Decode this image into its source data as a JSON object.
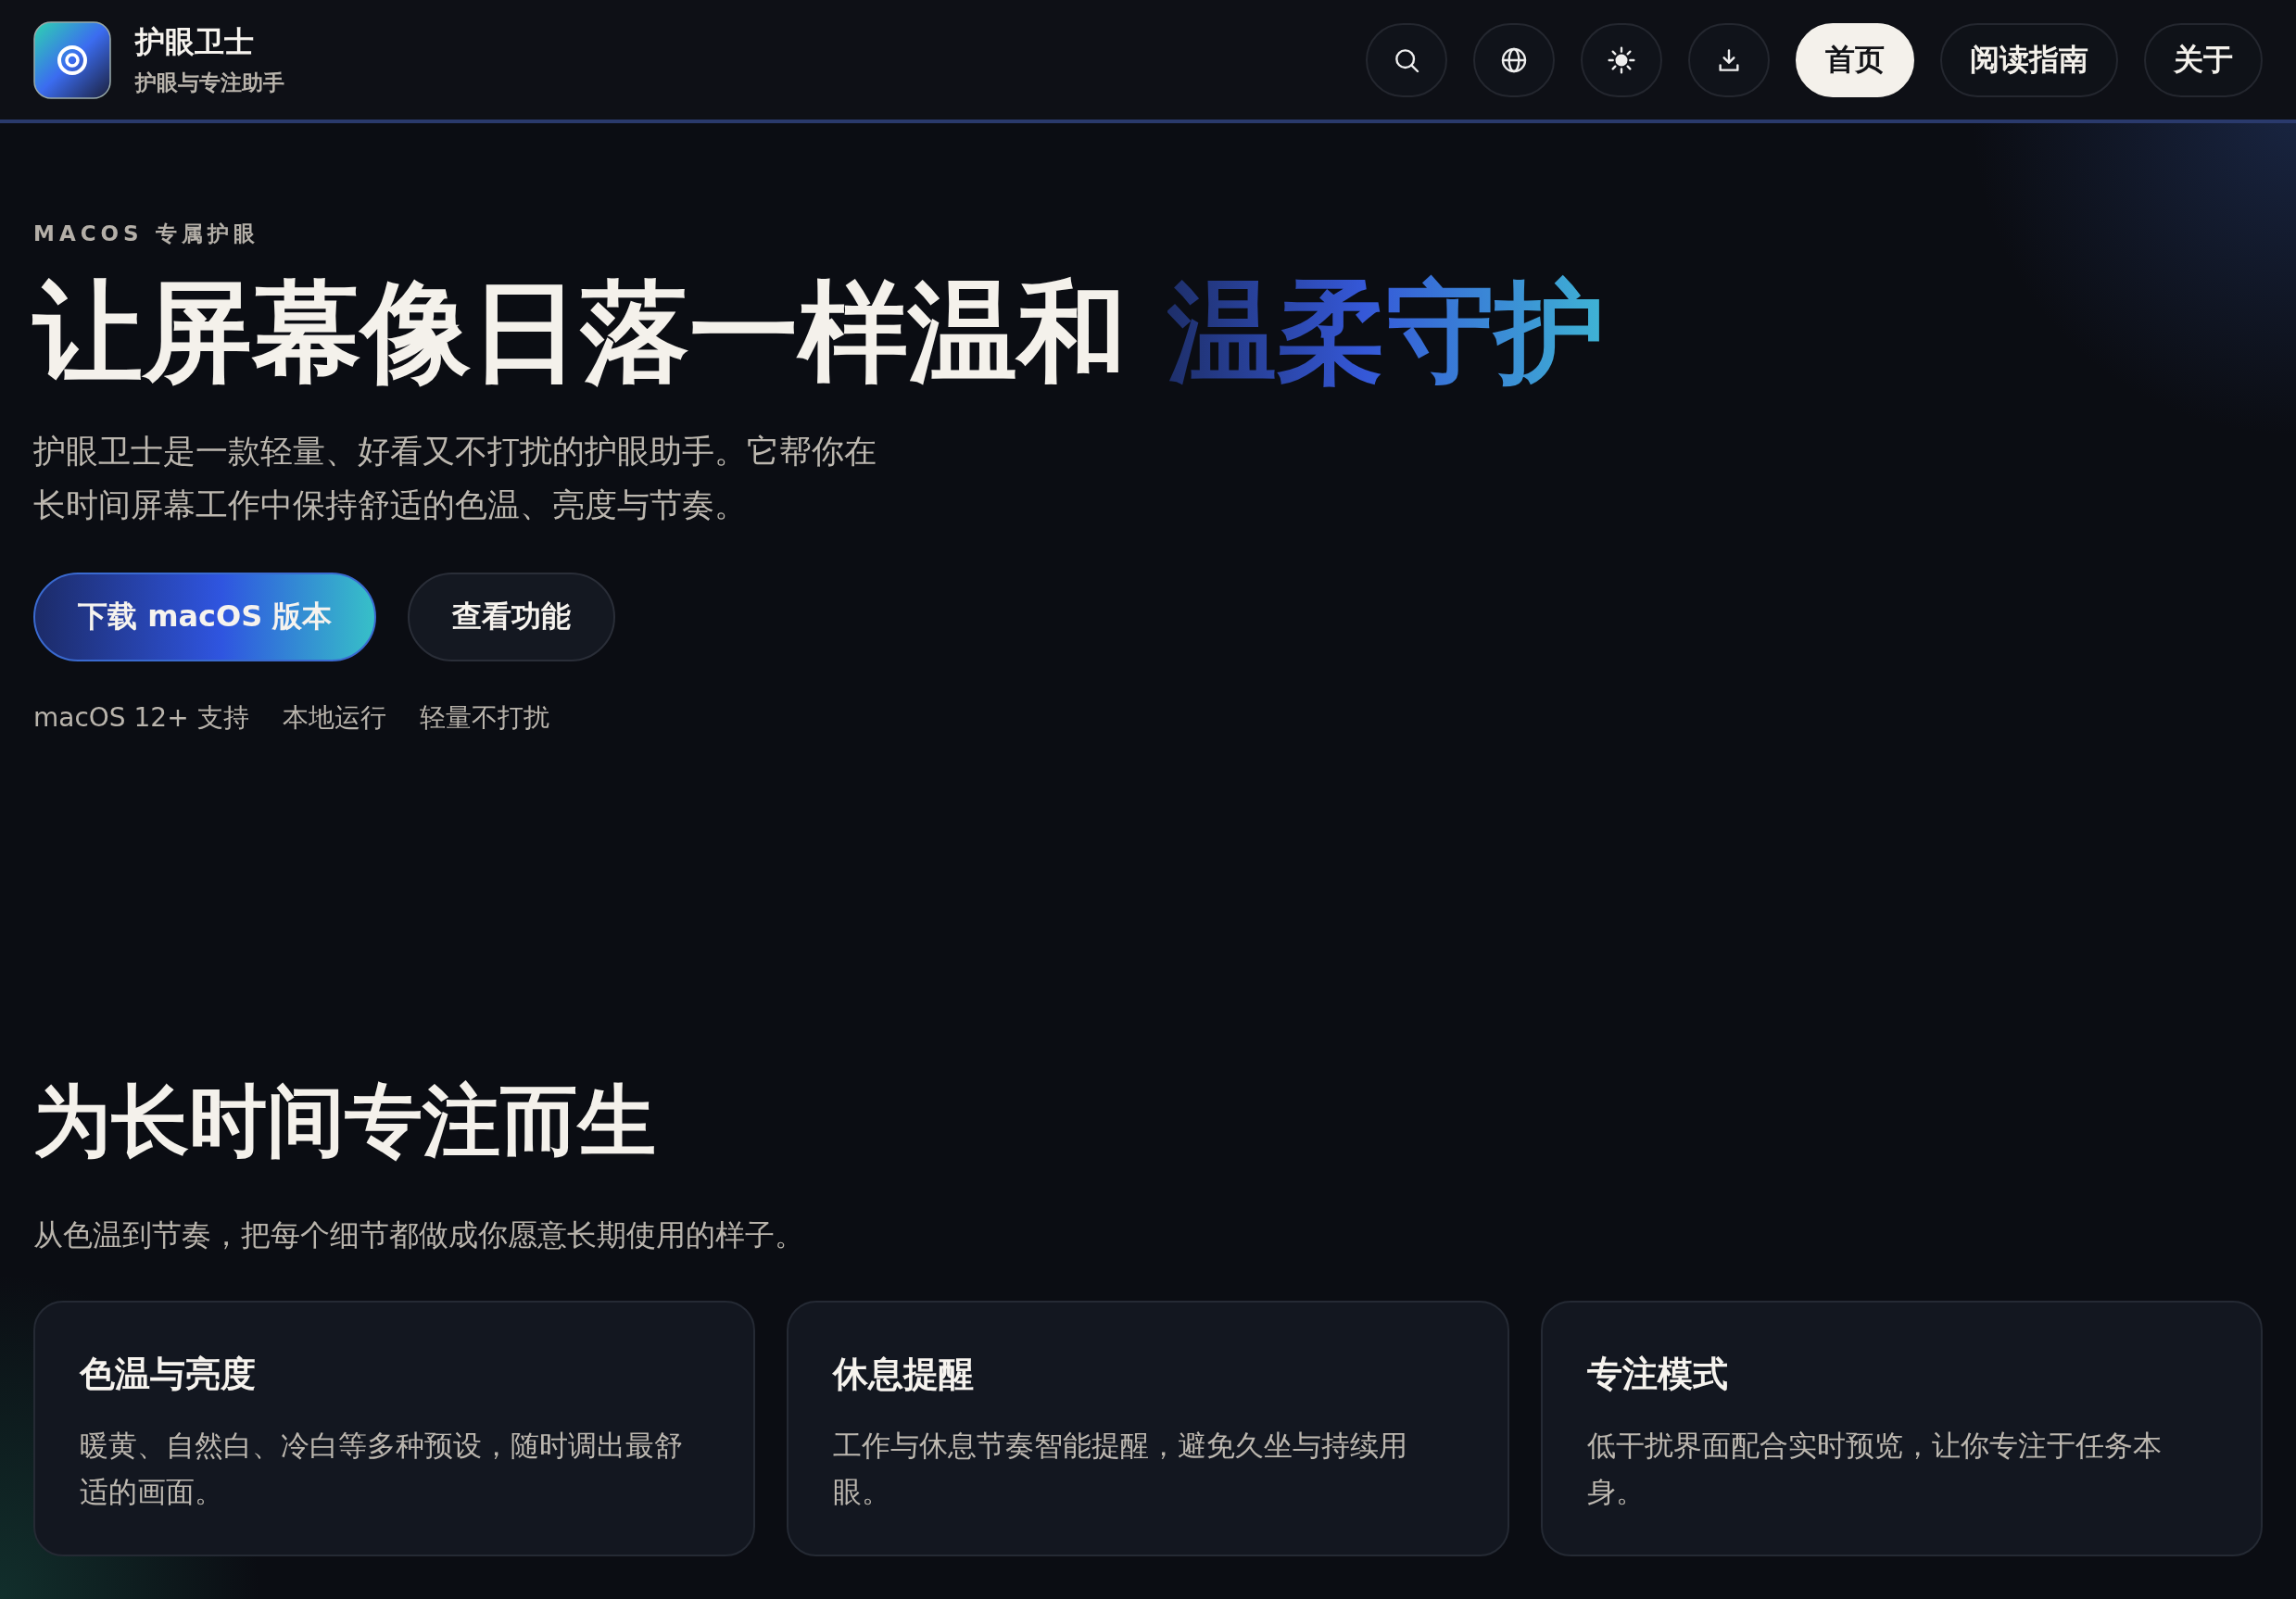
{
  "brand": {
    "name": "护眼卫士",
    "tagline": "护眼与专注助手"
  },
  "nav": [
    {
      "label": "首页",
      "selected": true
    },
    {
      "label": "阅读指南",
      "selected": false
    },
    {
      "label": "关于",
      "selected": false
    }
  ],
  "hero": {
    "eyebrow": "MACOS 专属护眼",
    "title": "让屏幕像日落一样温和",
    "highlight": "温柔守护",
    "description": [
      "护眼卫士是一款轻量、好看又不打扰的护眼助手。它帮你在",
      "长时间屏幕工作中保持舒适的色温、亮度与节奏。"
    ],
    "buttons": [
      {
        "label": "下载 macOS 版本",
        "kind": "primary"
      },
      {
        "label": "查看功能",
        "kind": "secondary"
      }
    ],
    "tags": [
      "macOS 12+ 支持",
      "本地运行",
      "轻量不打扰"
    ]
  },
  "features": {
    "title": "为长时间专注而生",
    "subtitle": "从色温到节奏，把每个细节都做成你愿意长期使用的样子。",
    "cards": [
      {
        "title": "色温与亮度",
        "text": "暖黄、自然白、冷白等多种预设，随时调出最舒适的画面。"
      },
      {
        "title": "休息提醒",
        "text": "工作与休息节奏智能提醒，避免久坐与持续用眼。"
      },
      {
        "title": "专注模式",
        "text": "低干扰界面配合实时预览，让你专注于任务本身。"
      }
    ]
  }
}
